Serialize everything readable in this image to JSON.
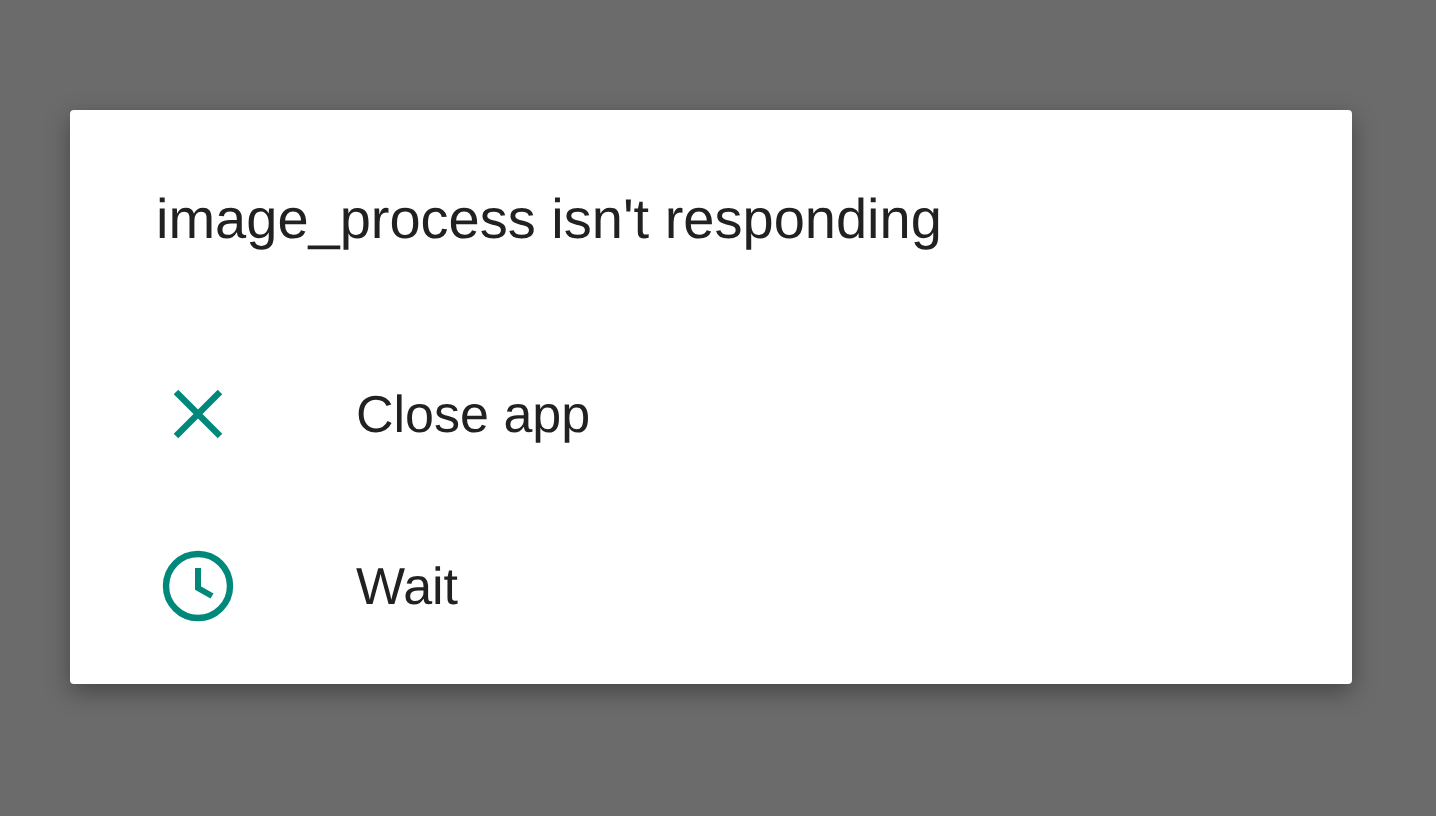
{
  "dialog": {
    "title": "image_process isn't responding",
    "options": [
      {
        "kind": "close",
        "label": "Close app"
      },
      {
        "kind": "wait",
        "label": "Wait"
      }
    ]
  }
}
